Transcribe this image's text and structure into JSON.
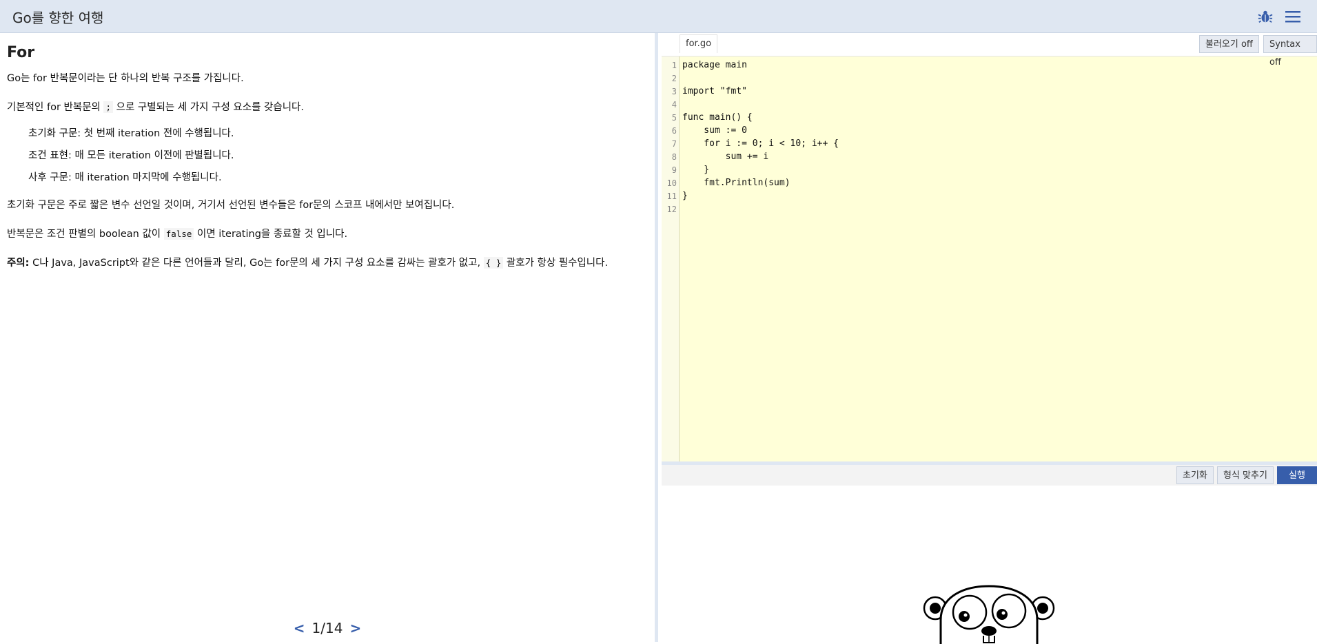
{
  "header": {
    "title": "Go를 향한 여행"
  },
  "lesson": {
    "heading": "For",
    "p1": "Go는 for 반복문이라는 단 하나의 반복 구조를 가집니다.",
    "p2": "기본적인 for 반복문의 ; 으로 구별되는 세 가지 구성 요소를 갖습니다.",
    "p2_before": "기본적인 for 반복문의 ",
    "p2_code": ";",
    "p2_after": " 으로 구별되는 세 가지 구성 요소를 갖습니다.",
    "list": [
      "초기화 구문: 첫 번째 iteration 전에 수행됩니다.",
      "조건 표현: 매 모든 iteration 이전에 판별됩니다.",
      "사후 구문: 매 iteration 마지막에 수행됩니다."
    ],
    "p3": "초기화 구문은 주로 짧은 변수 선언일 것이며, 거기서 선언된 변수들은 for문의 스코프 내에서만 보여집니다.",
    "p4_before": "반복문은 조건 판별의 boolean 값이 ",
    "p4_code": "false",
    "p4_after": " 이면 iterating을 종료할 것 입니다.",
    "note_label": "주의:",
    "note_before": " C나 Java, JavaScript와 같은 다른 언어들과 달리, Go는 for문의 세 가지 구성 요소를 감싸는 괄호가 없고, ",
    "note_code": "{ }",
    "note_after": " 괄호가 항상 필수입니다."
  },
  "pager": {
    "prev": "<",
    "count": "1/14",
    "next": ">"
  },
  "editor": {
    "filename": "for.go",
    "imports_btn": "불러오기 off",
    "syntax_btn": "Syntax off",
    "lines": [
      "package main",
      "",
      "import \"fmt\"",
      "",
      "func main() {",
      "    sum := 0",
      "    for i := 0; i < 10; i++ {",
      "        sum += i",
      "    }",
      "    fmt.Println(sum)",
      "}",
      ""
    ],
    "line_numbers": [
      "1",
      "2",
      "3",
      "4",
      "5",
      "6",
      "7",
      "8",
      "9",
      "10",
      "11",
      "12"
    ]
  },
  "toolbar": {
    "reset": "초기화",
    "format": "형식 맞추기",
    "run": "실행"
  },
  "colors": {
    "accent": "#375eab",
    "header_bg": "#dfe7f2",
    "editor_bg": "#ffffd8"
  },
  "icons": {
    "bug": "bug-icon",
    "menu": "hamburger-menu-icon",
    "gopher": "gopher-mascot"
  }
}
